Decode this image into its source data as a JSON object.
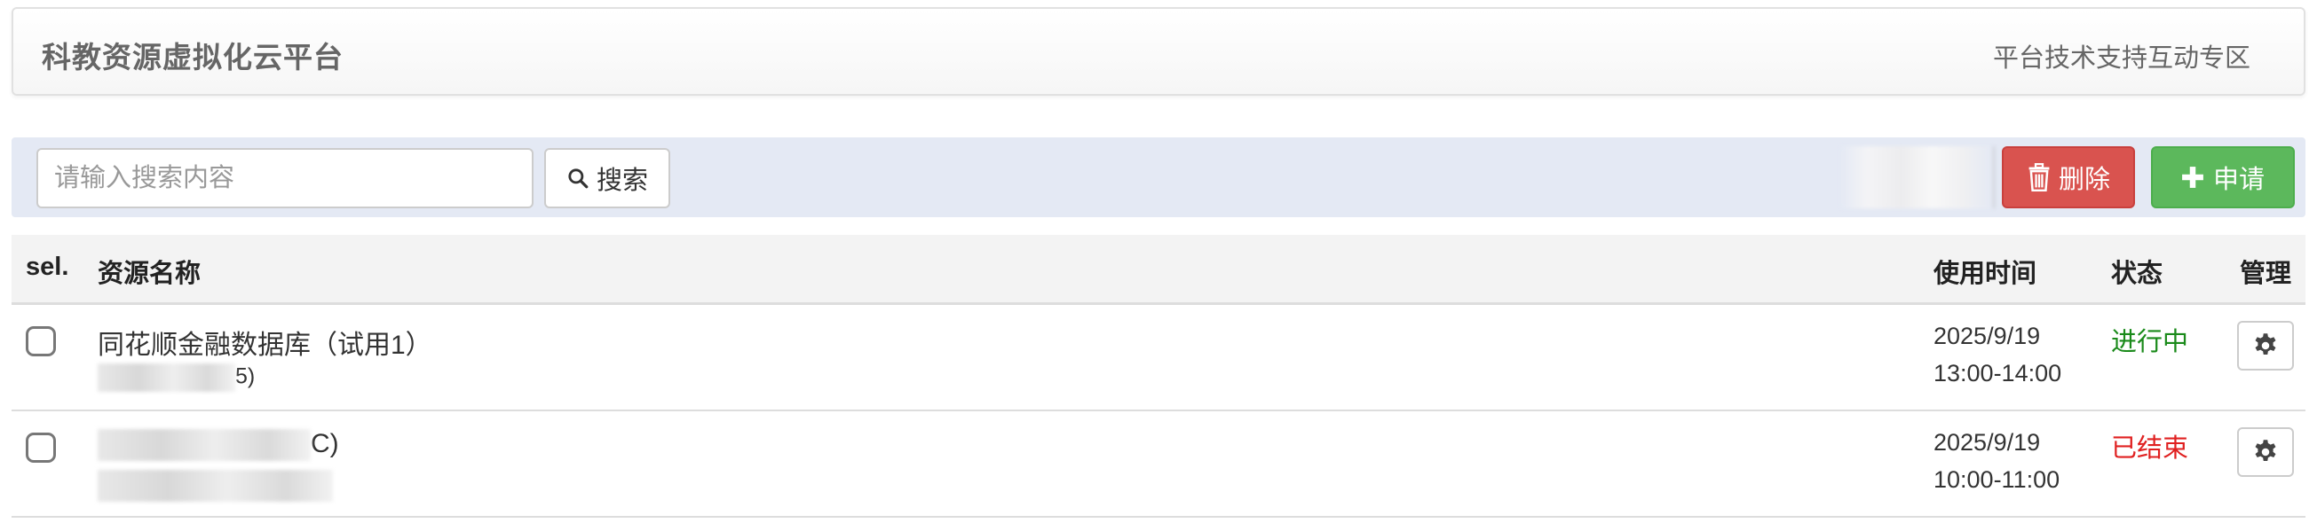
{
  "header": {
    "brand": "科教资源虚拟化云平台",
    "support_link": "平台技术支持互动专区"
  },
  "toolbar": {
    "search_placeholder": "请输入搜索内容",
    "search_label": "搜索",
    "delete_label": "删除",
    "apply_label": "申请"
  },
  "table": {
    "columns": {
      "sel": "sel.",
      "name": "资源名称",
      "time": "使用时间",
      "status": "状态",
      "manage": "管理"
    },
    "rows": [
      {
        "name": "同花顺金融数据库（试用1）",
        "sub_suffix": "5)",
        "date": "2025/9/19",
        "time": "13:00-14:00",
        "status": "进行中",
        "status_color": "#1a8a1a"
      },
      {
        "name_suffix": "C)",
        "date": "2025/9/19",
        "time": "10:00-11:00",
        "status": "已结束",
        "status_color": "#e02020"
      }
    ]
  },
  "colors": {
    "danger": "#d9534f",
    "success": "#5cb85c",
    "toolbar_bg": "#e4e9f4"
  },
  "icons": [
    "search-icon",
    "trash-icon",
    "plus-icon",
    "gear-icon"
  ]
}
